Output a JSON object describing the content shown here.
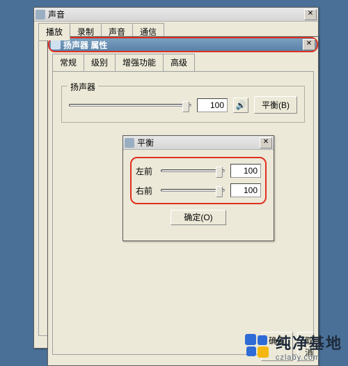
{
  "parent_window": {
    "title": "声音",
    "tabs": [
      "播放",
      "录制",
      "声音",
      "通信"
    ],
    "active_tab_index": 0,
    "buttons": {
      "ok": "确定",
      "cancel": "取消"
    }
  },
  "properties_window": {
    "title": "扬声器 属性",
    "tabs": [
      "常规",
      "级别",
      "增强功能",
      "高级"
    ],
    "active_tab_index": 1,
    "groupbox_label": "扬声器",
    "speaker_value": "100",
    "balance_button": "平衡(B)",
    "buttons": {
      "ok": "确定",
      "cancel": "取消"
    }
  },
  "balance_window": {
    "title": "平衡",
    "left_label": "左前",
    "right_label": "右前",
    "left_value": "100",
    "right_value": "100",
    "ok_button": "确定(O)"
  },
  "icons": {
    "speaker_glyph": "🔊"
  },
  "watermark": {
    "title": "纯净基地",
    "subtitle": "czlaby.com"
  }
}
